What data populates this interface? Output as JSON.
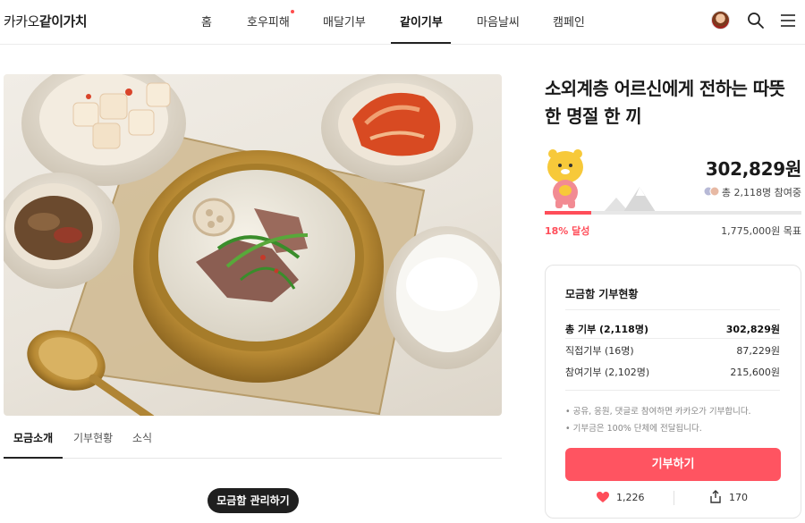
{
  "header": {
    "logo_light": "카카오",
    "logo_bold": "같이가치",
    "nav": [
      {
        "label": "홈"
      },
      {
        "label": "호우피해",
        "badge": "new"
      },
      {
        "label": "매달기부"
      },
      {
        "label": "같이기부",
        "active": true
      },
      {
        "label": "마음날씨"
      },
      {
        "label": "캠페인"
      }
    ],
    "icons": [
      "avatar",
      "search-icon",
      "menu-icon"
    ]
  },
  "campaign": {
    "title": "소외계층 어르신에게 전하는 따뜻한 명절 한 끼",
    "amount": "302,829원",
    "participants": "총 2,118명 참여중",
    "progress_percent": 18,
    "progress_label": "18% 달성",
    "goal": "1,775,000원 목표"
  },
  "tabs": [
    {
      "label": "모금소개",
      "active": true
    },
    {
      "label": "기부현황"
    },
    {
      "label": "소식"
    }
  ],
  "manage_button": "모금함 관리하기",
  "status_card": {
    "title": "모금함 기부현황",
    "rows": [
      {
        "label": "총 기부 (2,118명)",
        "value": "302,829원"
      },
      {
        "label": "직접기부 (16명)",
        "value": "87,229원"
      },
      {
        "label": "참여기부 (2,102명)",
        "value": "215,600원"
      }
    ],
    "notes": [
      "• 공유, 응원, 댓글로 참여하면 카카오가 기부합니다.",
      "• 기부금은 100% 단체에 전달됩니다."
    ],
    "donate_button": "기부하기",
    "likes": "1,226",
    "shares": "170"
  },
  "colors": {
    "accent": "#ff5461",
    "progress": "#ff4d59",
    "text": "#1a1a1a"
  }
}
